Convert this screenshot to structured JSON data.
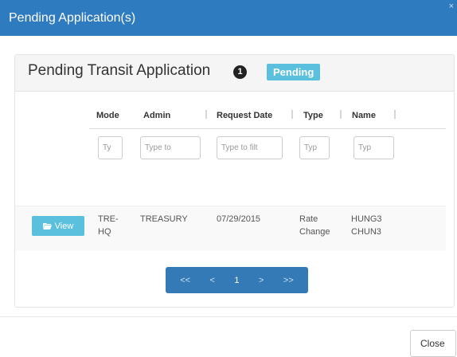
{
  "dialog": {
    "title": "Pending Application(s)",
    "close_mark": "×"
  },
  "panel": {
    "title": "Pending Transit Application",
    "count": "1",
    "status": "Pending"
  },
  "table": {
    "columns": [
      "Mode",
      "Admin",
      "Request Date",
      "Type",
      "Name"
    ],
    "filters": [
      "Ty",
      "Type to",
      "Type to filt",
      "Typ",
      "Typ"
    ],
    "rows": [
      {
        "action": "View",
        "mode": [
          "TRE-",
          "HQ"
        ],
        "admin": "TREASURY",
        "request_date": "07/29/2015",
        "type": [
          "Rate",
          "Change"
        ],
        "name": [
          "HUNG3",
          "CHUN3"
        ]
      }
    ]
  },
  "pagination": {
    "first": "<<",
    "prev": "<",
    "current": "1",
    "next": ">",
    "last": ">>"
  },
  "footer": {
    "close_label": "Close"
  },
  "colors": {
    "header_bg": "#2f7bbf",
    "badge_info": "#5bc0de",
    "pagination_bg": "#337ab7"
  }
}
